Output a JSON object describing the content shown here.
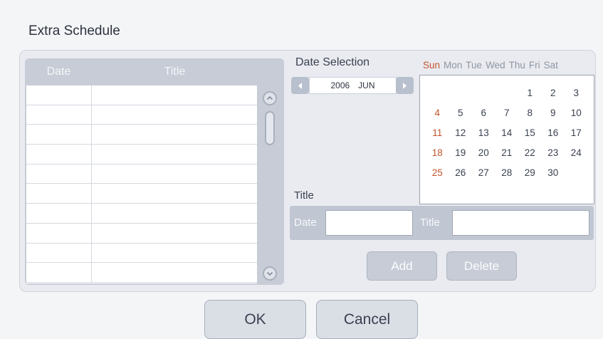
{
  "dialog": {
    "title": "Extra Schedule"
  },
  "table": {
    "headers": {
      "date": "Date",
      "title": "Title"
    },
    "rows": [
      {
        "date": "",
        "title": ""
      },
      {
        "date": "",
        "title": ""
      },
      {
        "date": "",
        "title": ""
      },
      {
        "date": "",
        "title": ""
      },
      {
        "date": "",
        "title": ""
      },
      {
        "date": "",
        "title": ""
      },
      {
        "date": "",
        "title": ""
      },
      {
        "date": "",
        "title": ""
      },
      {
        "date": "",
        "title": ""
      },
      {
        "date": "",
        "title": ""
      }
    ],
    "scroll_icons": {
      "up": "chevron-up-icon",
      "down": "chevron-down-icon"
    }
  },
  "date_selection": {
    "label": "Date Selection",
    "year": "2006",
    "month": "JUN",
    "nav_icons": {
      "prev": "chevron-left-icon",
      "next": "chevron-right-icon"
    }
  },
  "calendar": {
    "weekdays": [
      "Sun",
      "Mon",
      "Tue",
      "Wed",
      "Thu",
      "Fri",
      "Sat"
    ],
    "weeks": [
      [
        "",
        "",
        "",
        "",
        "1",
        "2",
        "3"
      ],
      [
        "4",
        "5",
        "6",
        "7",
        "8",
        "9",
        "10"
      ],
      [
        "11",
        "12",
        "13",
        "14",
        "15",
        "16",
        "17"
      ],
      [
        "18",
        "19",
        "20",
        "21",
        "22",
        "23",
        "24"
      ],
      [
        "25",
        "26",
        "27",
        "28",
        "29",
        "30",
        ""
      ]
    ]
  },
  "entry": {
    "section_label": "Title",
    "date_label": "Date",
    "date_value": "",
    "title_label": "Title",
    "title_value": ""
  },
  "actions": {
    "add": "Add",
    "delete": "Delete"
  },
  "footer": {
    "ok": "OK",
    "cancel": "Cancel"
  },
  "colors": {
    "sunday": "#c2552d",
    "panel": "#e9ebf0",
    "header": "#c7ccd6"
  }
}
